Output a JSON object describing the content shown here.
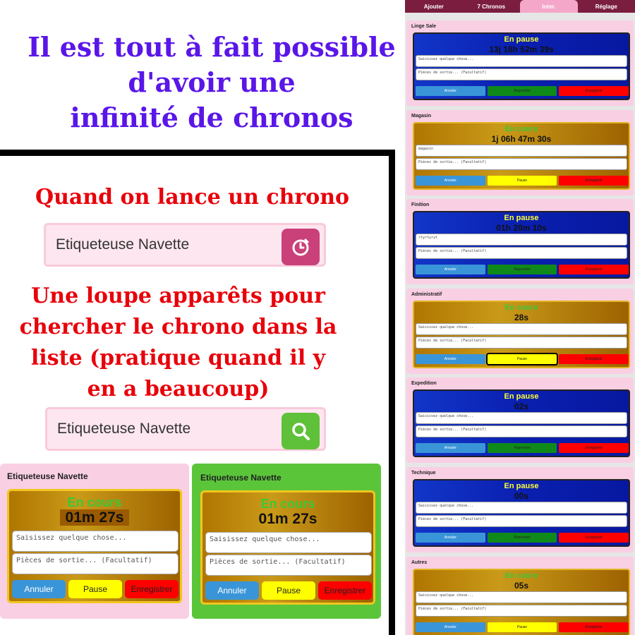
{
  "headline": [
    "Il est tout à fait possible",
    "d'avoir une",
    "infinité de chronos"
  ],
  "launch_text": "Quand on lance un chrono",
  "search_text": [
    "Une loupe apparêts pour",
    "chercher le chrono dans la",
    "liste (pratique quand il y",
    "en a beaucoup)"
  ],
  "search_box_1": {
    "value": "Etiqueteuse Navette",
    "button_icon": "timer-icon"
  },
  "search_box_2": {
    "value": "Etiqueteuse Navette",
    "button_icon": "search-icon"
  },
  "big_cards": [
    {
      "title": "Etiqueteuse Navette",
      "status": "En cours",
      "time": "01m 27s",
      "placeholder1": "Saisissez quelque chose...",
      "placeholder2": "Pièces de sortie... (Facultatif)",
      "btn_cancel": "Annuler",
      "btn_pause": "Pause",
      "btn_save": "Enregistrer"
    },
    {
      "title": "Etiqueteuse Navette",
      "status": "En cours",
      "time": "01m 27s",
      "placeholder1": "Saisissez quelque chose...",
      "placeholder2": "Pièces de sortie... (Facultatif)",
      "btn_cancel": "Annuler",
      "btn_pause": "Pause",
      "btn_save": "Enregistrer"
    }
  ],
  "tabs": [
    "Ajouter",
    "7 Chronos",
    "Inter.",
    "Réglage"
  ],
  "active_tab": "Inter.",
  "mobile_cards": [
    {
      "title": "Linge Sale",
      "status": "En pause",
      "time": "13j 18h 52m 39s",
      "field1": "Saisissez quelque chose...",
      "field2": "Pièces de sortie... (Facultatif)",
      "btn_cancel": "Annuler",
      "btn_mid": "Reprendre",
      "btn_save": "Enregistrer"
    },
    {
      "title": "Magasin",
      "status": "En cours",
      "time": "1j 06h 47m 30s",
      "field1": "magazin",
      "field2": "Pièces de sortie... (Facultatif)",
      "btn_cancel": "Annuler",
      "btn_mid": "Pause",
      "btn_save": "Enregistrer"
    },
    {
      "title": "Finition",
      "status": "En pause",
      "time": "01h 20m 10s",
      "field1": "rtyrtyryt",
      "field2": "Pièces de sortie... (Facultatif)",
      "btn_cancel": "Annuler",
      "btn_mid": "Reprendre",
      "btn_save": "Enregistrer"
    },
    {
      "title": "Administratif",
      "status": "En cours",
      "time": "28s",
      "field1": "Saisissez quelque chose...",
      "field2": "Pièces de sortie... (Facultatif)",
      "btn_cancel": "Annuler",
      "btn_mid": "Pause",
      "btn_save": "Enregistrer"
    },
    {
      "title": "Expedition",
      "status": "En pause",
      "time": "02s",
      "field1": "Saisissez quelque chose...",
      "field2": "Pièces de sortie... (Facultatif)",
      "btn_cancel": "Annuler",
      "btn_mid": "Reprendre",
      "btn_save": "Enregistrer"
    },
    {
      "title": "Technique",
      "status": "En pause",
      "time": "00s",
      "field1": "Saisissez quelque chose...",
      "field2": "Pièces de sortie... (Facultatif)",
      "btn_cancel": "Annuler",
      "btn_mid": "Reprendre",
      "btn_save": "Enregistrer"
    },
    {
      "title": "Autres",
      "status": "En cours",
      "time": "05s",
      "field1": "Saisissez quelque chose...",
      "field2": "Pièces de sortie... (Facultatif)",
      "btn_cancel": "Annuler",
      "btn_mid": "Pause",
      "btn_save": "Enregistrer"
    }
  ],
  "colors": {
    "headline": "#5a16e8",
    "annotation": "#e8000a",
    "running_status": "#39c839",
    "paused_status": "#ffff33"
  }
}
